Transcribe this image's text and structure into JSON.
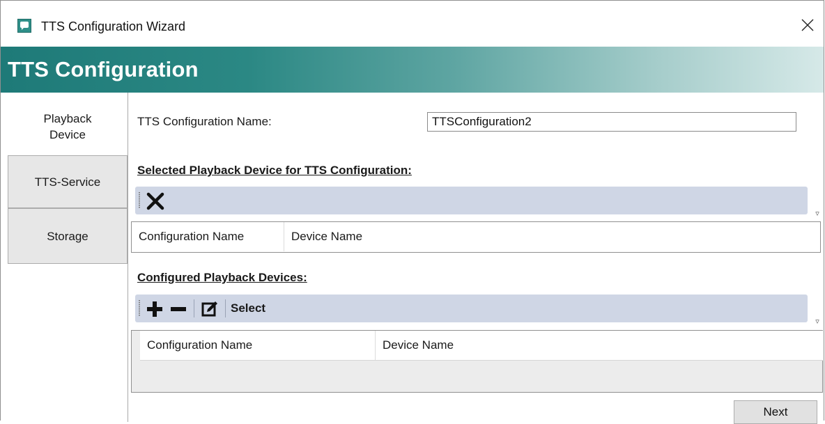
{
  "window": {
    "title": "TTS Configuration Wizard",
    "close_glyph": "✕"
  },
  "banner": {
    "title": "TTS Configuration"
  },
  "nav": {
    "tabs": [
      {
        "line1": "Playback",
        "line2": "Device",
        "active": true
      },
      {
        "label": "TTS-Service",
        "active": false
      },
      {
        "label": "Storage",
        "active": false
      }
    ]
  },
  "form": {
    "name_label": "TTS Configuration Name:",
    "name_value": "TTSConfiguration2"
  },
  "selected_section": {
    "heading": "Selected Playback Device for TTS Configuration:",
    "toolbar": {
      "remove_icon": "close-icon"
    },
    "columns": [
      "Configuration Name",
      "Device Name"
    ]
  },
  "configured_section": {
    "heading": "Configured Playback Devices:",
    "toolbar": {
      "add_icon": "plus-icon",
      "remove_icon": "minus-icon",
      "edit_icon": "edit-icon",
      "select_label": "Select"
    },
    "columns": [
      "Configuration Name",
      "Device Name"
    ]
  },
  "footer": {
    "next_label": "Next"
  },
  "colors": {
    "banner_start": "#1e7a78",
    "banner_end": "#d6e9e8",
    "toolbar_bg": "#cfd6e5"
  }
}
